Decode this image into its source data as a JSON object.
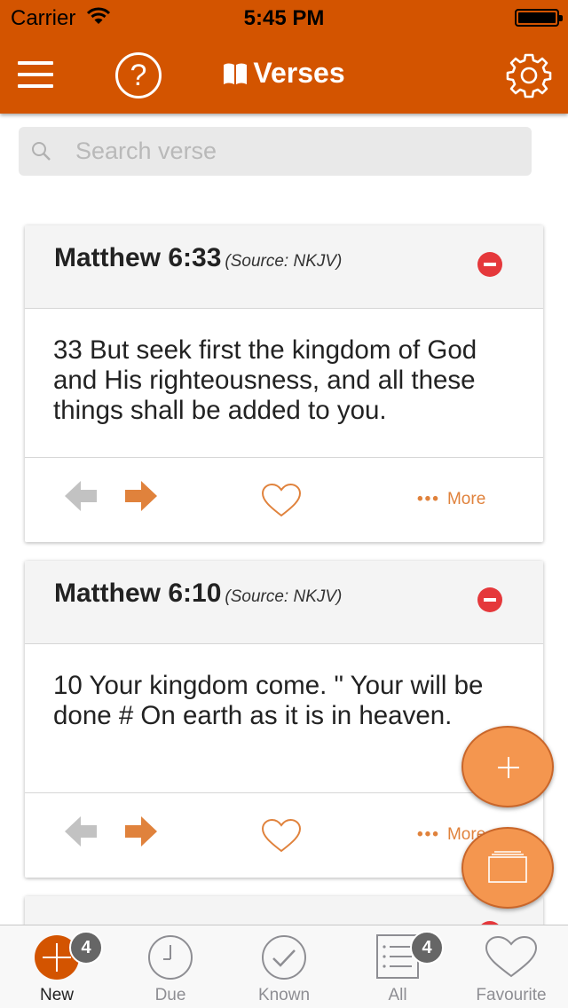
{
  "status_bar": {
    "carrier": "Carrier",
    "time": "5:45 PM"
  },
  "nav": {
    "title": "Verses",
    "help_label": "?"
  },
  "search": {
    "placeholder": "Search verse",
    "value": ""
  },
  "cards": [
    {
      "reference": "Matthew 6:33",
      "source": "(Source: NKJV)",
      "text": "33 But seek first the kingdom of God and His righteousness, and all these things shall be added to you.",
      "more_label": "More",
      "more_dots": "•••"
    },
    {
      "reference": "Matthew 6:10",
      "source": "(Source: NKJV)",
      "text": "10 Your kingdom come. \" Your will be done # On earth as it is in heaven.",
      "more_label": "More",
      "more_dots": "•••"
    }
  ],
  "tabs": [
    {
      "label": "New",
      "badge": "4",
      "icon": "plus-circle-icon"
    },
    {
      "label": "Due",
      "icon": "clock-icon"
    },
    {
      "label": "Known",
      "icon": "check-circle-icon"
    },
    {
      "label": "All",
      "badge": "4",
      "icon": "list-icon"
    },
    {
      "label": "Favourite",
      "icon": "heart-icon"
    }
  ],
  "colors": {
    "primary": "#d35400",
    "accent": "#e0823c",
    "fab": "#f4964f",
    "remove": "#e5383b"
  }
}
